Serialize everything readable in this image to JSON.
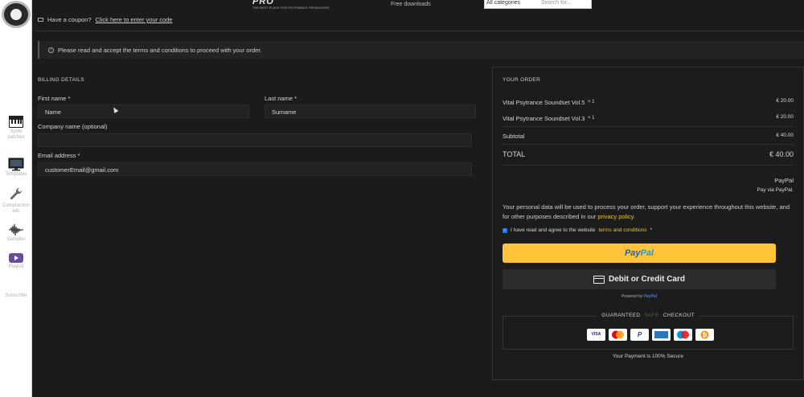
{
  "sidebar": {
    "items": [
      {
        "label": "Synth\npatches"
      },
      {
        "label": "Templates"
      },
      {
        "label": "Construction\nkits"
      },
      {
        "label": "Samples"
      },
      {
        "label": "Playlist"
      },
      {
        "label": "Subscribe"
      }
    ]
  },
  "header": {
    "logo_text": "PRO",
    "logo_tagline": "THE BEST PLACE FOR PSYTRANCE PRODUCERS",
    "free_downloads": "Free downloads",
    "search_category": "All categories",
    "search_placeholder": "Search for..."
  },
  "coupon": {
    "prefix": "Have a coupon?",
    "link": "Click here to enter your code"
  },
  "notice": {
    "text": "Please read and accept the terms and conditions to proceed with your order."
  },
  "billing": {
    "title": "BILLING DETAILS",
    "first_name_label": "First name *",
    "first_name_value": "Name",
    "last_name_label": "Last name *",
    "last_name_value": "Surname",
    "company_label": "Company name (optional)",
    "company_value": "",
    "email_label": "Email address *",
    "email_value": "customerEmail@gmail.com"
  },
  "order": {
    "title": "YOUR ORDER",
    "items": [
      {
        "name": "Vital Psytrance Soundset Vol.5",
        "qty": "× 1",
        "price": "€ 20.00"
      },
      {
        "name": "Vital Psytrance Soundset Vol.3",
        "qty": "× 1",
        "price": "€ 20.00"
      }
    ],
    "subtotal_label": "Subtotal",
    "subtotal_value": "€ 40.00",
    "total_label": "TOTAL",
    "total_value": "€ 40.00",
    "payment_method": "PayPal",
    "payment_desc": "Pay via PayPal.",
    "policy_text": "Your personal data will be used to process your order, support your experience throughout this website, and for other purposes described in our",
    "policy_link": "privacy policy",
    "agree_text": "I have read and agree to the website",
    "agree_link": "terms and conditions",
    "agree_required": "*",
    "paypal_btn_pay": "Pay",
    "paypal_btn_pal": "Pal",
    "card_btn_label": "Debit or Credit Card",
    "powered_by": "Powered by",
    "powered_brand": "PayPal",
    "guaranteed_prefix": "GUARANTEED",
    "guaranteed_safe": "SAFE",
    "guaranteed_suffix": "CHECKOUT",
    "badges": [
      "VISA",
      "MC",
      "PP",
      "AMEX",
      "MAESTRO",
      "BTC"
    ],
    "secure_text": "Your Payment is 100% Secure"
  },
  "colors": {
    "background": "#1b1b1b",
    "accent_link": "#e2c44c",
    "paypal_yellow": "#ffc439",
    "paypal_blue": "#2c5ea8"
  }
}
